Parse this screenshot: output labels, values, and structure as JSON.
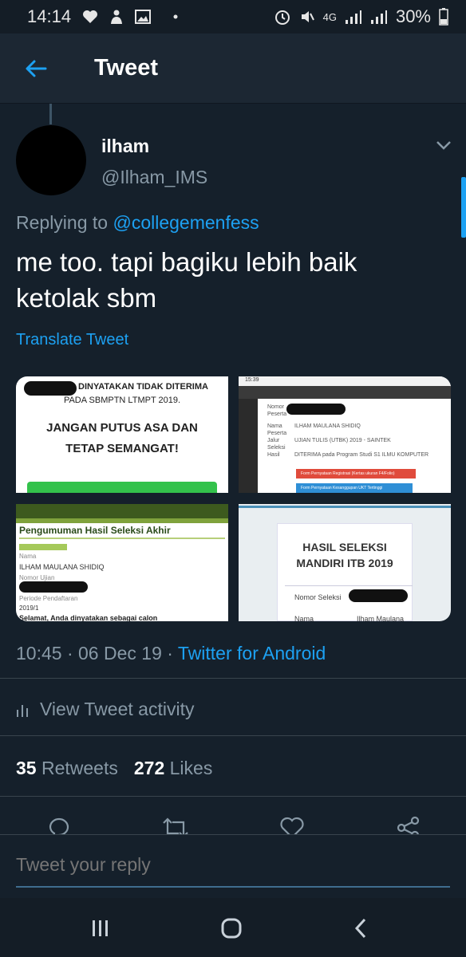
{
  "status_bar": {
    "time": "14:14",
    "network": "4G",
    "battery": "30%"
  },
  "header": {
    "title": "Tweet"
  },
  "tweet": {
    "name": "ilham",
    "handle": "@Ilham_IMS",
    "replying_prefix": "Replying to",
    "replying_handle": "@collegemenfess",
    "text": "me too. tapi bagiku lebih baik ketolak sbm",
    "translate_label": "Translate Tweet",
    "time": "10:45",
    "date": "06 Dec 19",
    "source": "Twitter for Android",
    "activity_label": "View Tweet activity",
    "retweets_count": "35",
    "retweets_label": "Retweets",
    "likes_count": "272",
    "likes_label": "Likes"
  },
  "media": {
    "m1": {
      "line1": "DINYATAKAN TIDAK DITERIMA",
      "line2": "PADA SBMPTN LTMPT 2019.",
      "line3": "JANGAN PUTUS ASA DAN",
      "line4": "TETAP SEMANGAT!"
    },
    "m2": {
      "time": "15:39",
      "rows": [
        {
          "label": "Nomor Peserta",
          "value": ""
        },
        {
          "label": "Nama Peserta",
          "value": "ILHAM MAULANA SHIDIQ"
        },
        {
          "label": "Jalur Seleksi",
          "value": "UJIAN TULIS (UTBK) 2019 - SAINTEK"
        },
        {
          "label": "Hasil",
          "value": "DITERIMA pada Program Studi S1 ILMU KOMPUTER"
        }
      ],
      "btn1": "Form Pernyataan Registrasi (Kertas ukuran F4/Folio)",
      "btn2": "Form Pernyataan Kesanggupan UKT Tertinggi"
    },
    "m3": {
      "title": "Pengumuman Hasil Seleksi Akhir",
      "label_nama": "Nama",
      "nama": "ILHAM MAULANA SHIDIQ",
      "label_nomor": "Nomor Ujian",
      "label_periode": "Periode Pendaftaran",
      "periode": "2019/1",
      "footer": "Selamat, Anda dinyatakan sebagai calon"
    },
    "m4": {
      "title_line1": "HASIL SELEKSI",
      "title_line2": "MANDIRI ITB 2019",
      "label_nomor": "Nomor Seleksi",
      "label_nama": "Nama",
      "nama": "Ilham Maulana"
    }
  },
  "reply": {
    "placeholder": "Tweet your reply"
  },
  "colors": {
    "background": "#15202b",
    "accent": "#1da1f2",
    "muted": "#8899a6"
  }
}
